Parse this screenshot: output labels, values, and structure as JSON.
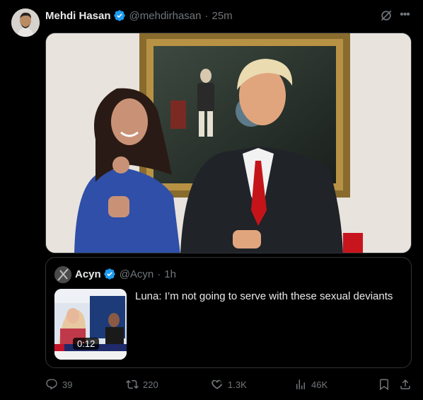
{
  "author": {
    "name": "Mehdi Hasan",
    "handle": "@mehdirhasan",
    "separator": "·",
    "time": "25m"
  },
  "quoted": {
    "name": "Acyn",
    "handle": "@Acyn",
    "separator": "·",
    "time": "1h",
    "text": "Luna: I’m not going to serve with these sexual deviants",
    "video_duration": "0:12"
  },
  "actions": {
    "replies": "39",
    "reposts": "220",
    "likes": "1.3K",
    "views": "46K"
  },
  "colors": {
    "background": "#000000",
    "verified": "#1d9bf0",
    "muted": "#71767b",
    "border": "#2f3336"
  },
  "icons": [
    "verified-badge-icon",
    "grok-icon",
    "more-icon",
    "reply-icon",
    "repost-icon",
    "like-icon",
    "views-icon",
    "bookmark-icon",
    "share-icon"
  ]
}
